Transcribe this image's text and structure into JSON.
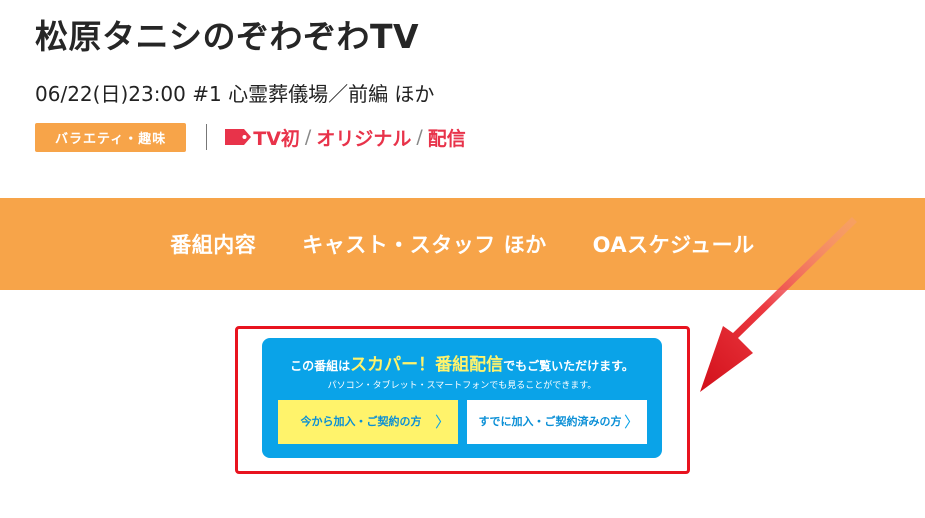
{
  "program": {
    "title": "松原タニシのぞわぞわTV",
    "airtime": "06/22(日)23:00 #1 心霊葬儀場／前編 ほか"
  },
  "meta": {
    "genre": "バラエティ・趣味",
    "tags": [
      "TV初",
      "オリジナル",
      "配信"
    ],
    "separator": "/"
  },
  "nav": {
    "items": [
      "番組内容",
      "キャスト・スタッフ ほか",
      "OAスケジュール"
    ]
  },
  "promo": {
    "line1_pre": "この番組は",
    "line1_highlight": "スカパー！番組配信",
    "line1_post": "でもご覧いただけます。",
    "line2": "パソコン・タブレット・スマートフォンでも見ることができます。",
    "new_button": "今から加入・ご契約の方",
    "existing_button": "すでに加入・ご契約済みの方",
    "chevron": "〉"
  },
  "colors": {
    "accent_orange": "#f7a449",
    "tag_red": "#e8334a",
    "promo_blue": "#0aa3e8",
    "promo_yellow": "#fff36b",
    "annotation_red": "#e8131f"
  },
  "icons": {
    "tag": "price-tag-icon",
    "chevron": "chevron-right-icon",
    "annotation": "arrow-icon"
  }
}
